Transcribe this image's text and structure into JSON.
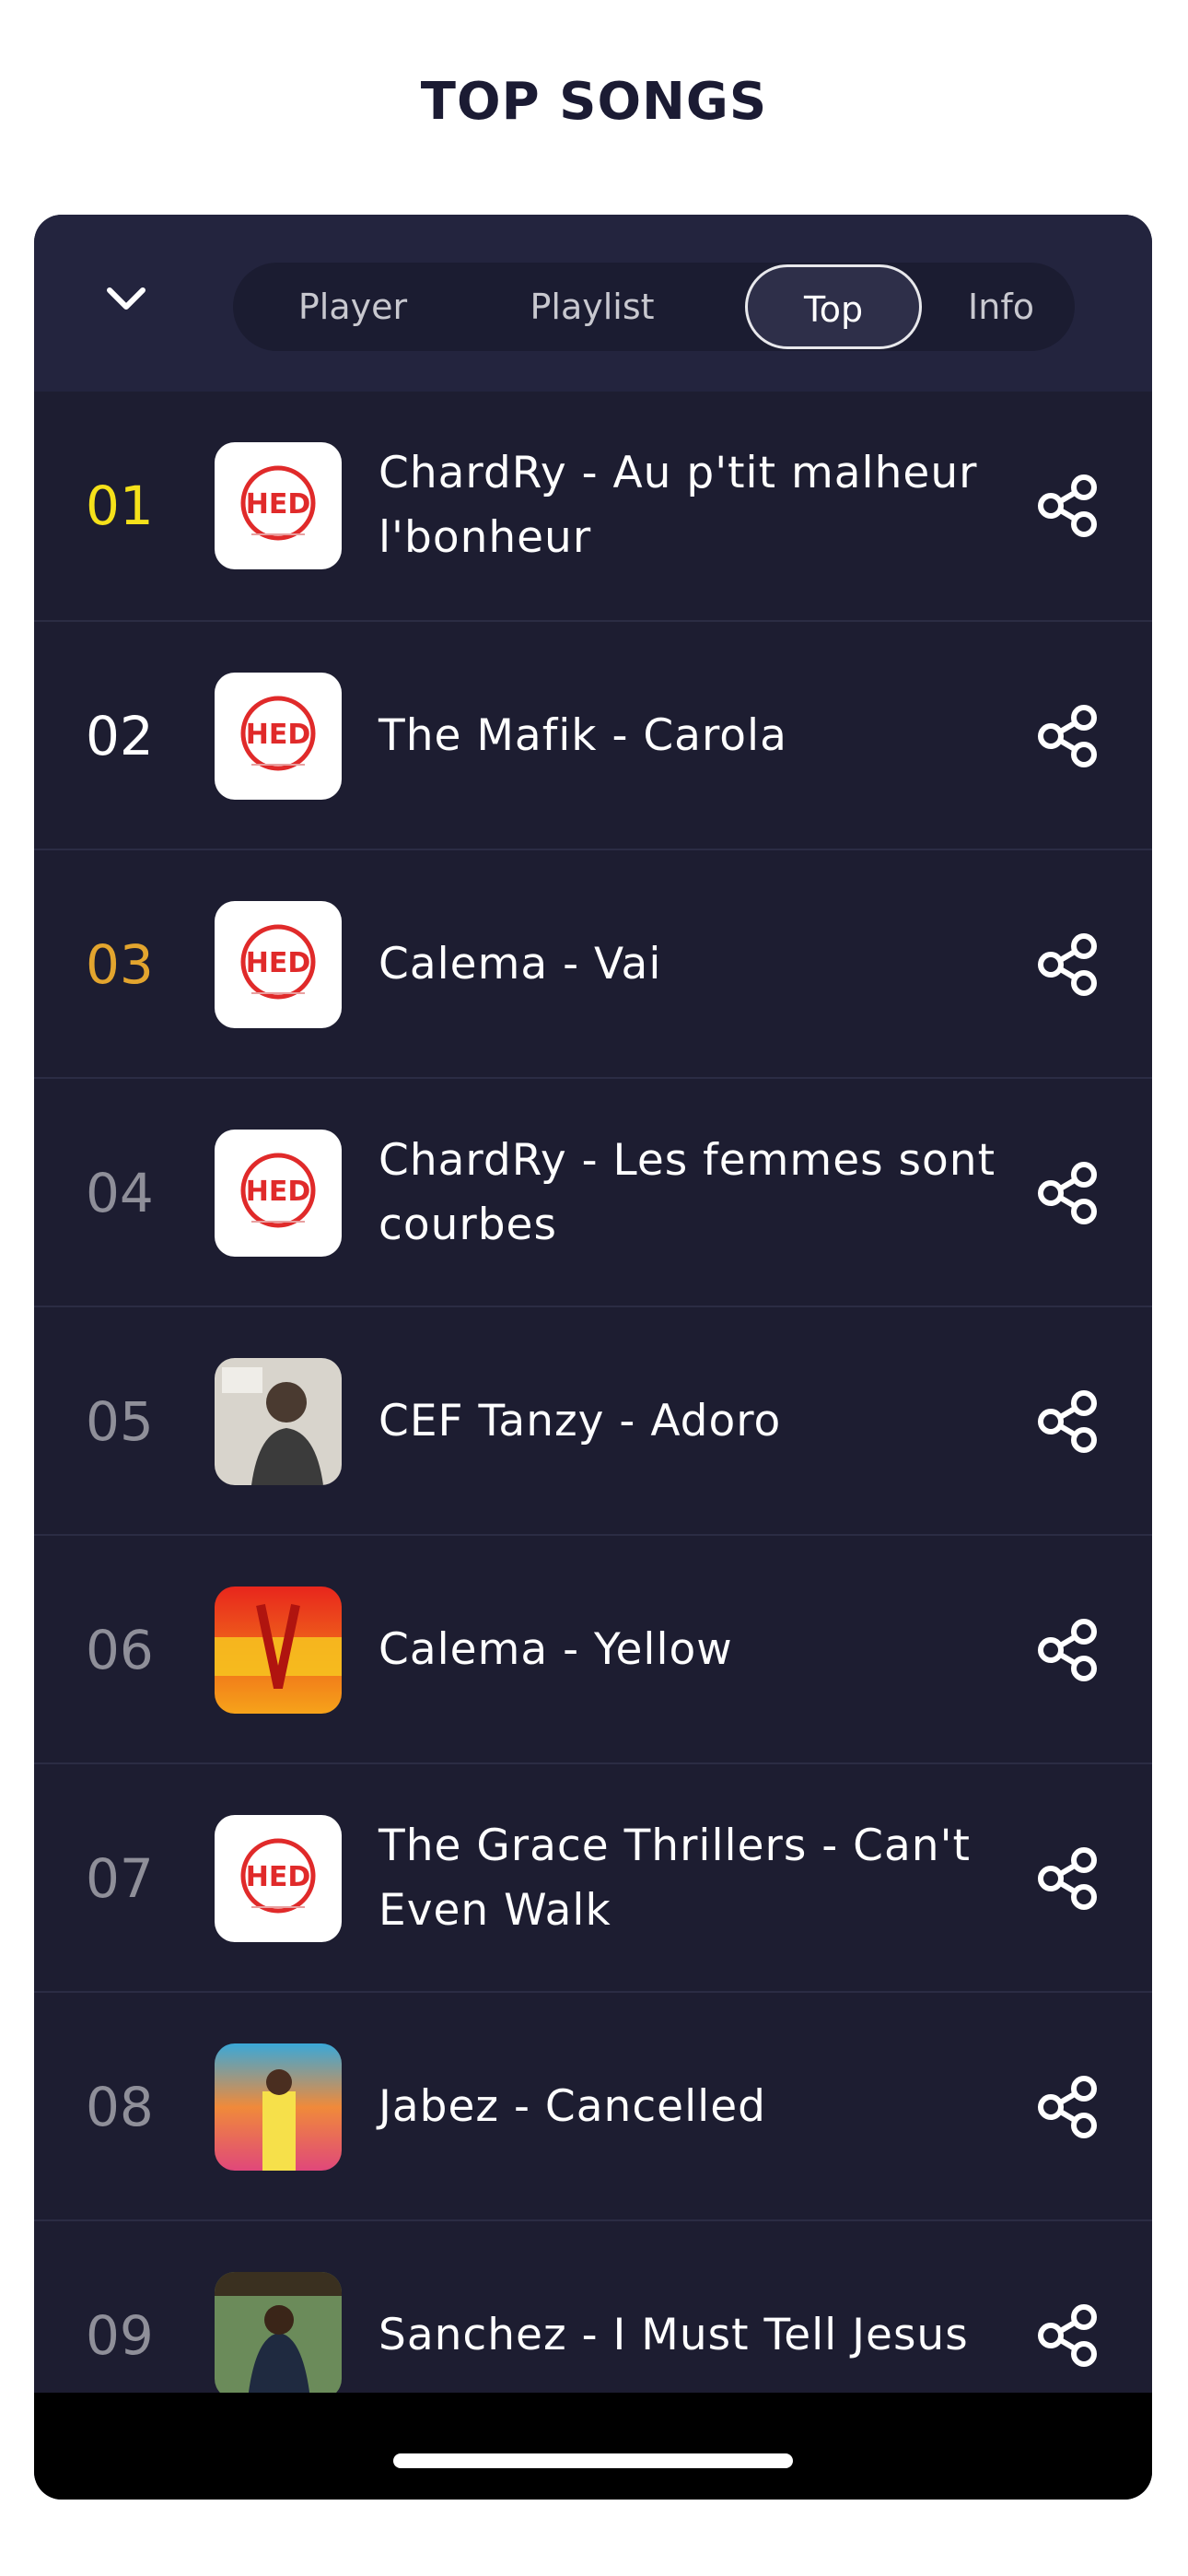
{
  "page": {
    "title": "TOP SONGS"
  },
  "header": {
    "collapse_icon": "chevron-down-icon",
    "tabs": [
      {
        "label": "Player",
        "active": false
      },
      {
        "label": "Playlist",
        "active": false
      },
      {
        "label": "Top",
        "active": true
      },
      {
        "label": "Info",
        "active": false
      }
    ]
  },
  "songs": [
    {
      "rank": "01",
      "title": "ChardRy - Au p'tit malheur l'bonheur",
      "rank_color": "#f5e11a",
      "cover": "station-logo"
    },
    {
      "rank": "02",
      "title": "The Mafik - Carola",
      "rank_color": "#ffffff",
      "cover": "station-logo"
    },
    {
      "rank": "03",
      "title": "Calema - Vai",
      "rank_color": "#e3a52e",
      "cover": "station-logo"
    },
    {
      "rank": "04",
      "title": "ChardRy - Les femmes sont courbes",
      "rank_color": "#8f8f99",
      "cover": "station-logo"
    },
    {
      "rank": "05",
      "title": "CEF Tanzy - Adoro",
      "rank_color": "#8f8f99",
      "cover": "album-art-tanzy"
    },
    {
      "rank": "06",
      "title": "Calema - Yellow",
      "rank_color": "#8f8f99",
      "cover": "album-art-yellow"
    },
    {
      "rank": "07",
      "title": "The Grace Thrillers - Can't Even Walk",
      "rank_color": "#8f8f99",
      "cover": "station-logo"
    },
    {
      "rank": "08",
      "title": "Jabez - Cancelled",
      "rank_color": "#8f8f99",
      "cover": "album-art-jabez"
    },
    {
      "rank": "09",
      "title": "Sanchez - I Must Tell Jesus",
      "rank_color": "#8f8f99",
      "cover": "album-art-sanchez"
    }
  ],
  "share_icon": "share-icon",
  "colors": {
    "background": "#ffffff",
    "card": "#1d1d31",
    "header": "#23243e",
    "accent_first": "#f5e11a",
    "accent_third": "#e3a52e",
    "logo_red": "#e02a2a"
  }
}
